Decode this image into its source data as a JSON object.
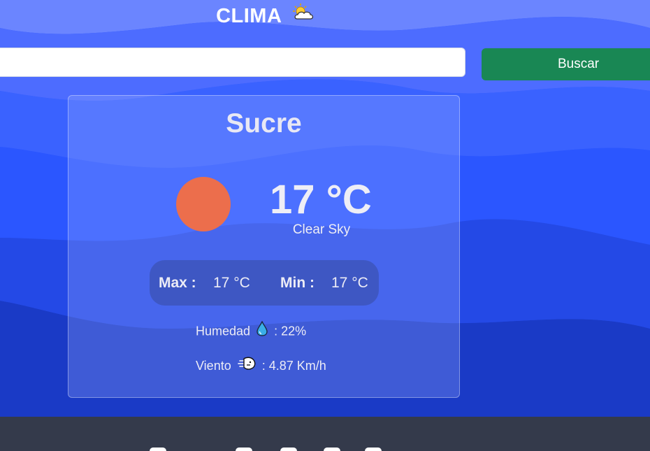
{
  "header": {
    "title": "CLIMA",
    "title_icon": "sun-behind-cloud-icon"
  },
  "search": {
    "value": "",
    "placeholder": "",
    "button_label": "Buscar"
  },
  "weather": {
    "city": "Sucre",
    "condition_icon": "sun-icon",
    "temperature": "17 °C",
    "description": "Clear Sky",
    "max_label": "Max :",
    "max_value": "17 °C",
    "min_label": "Min :",
    "min_value": "17 °C",
    "humidity_label": "Humedad",
    "humidity_icon": "droplet-icon",
    "humidity_value": ": 22%",
    "wind_label": "Viento",
    "wind_icon": "wind-face-icon",
    "wind_value": ": 4.87 Km/h"
  },
  "colors": {
    "background": "#2b58ff",
    "button": "#198754",
    "sun": "#ec6e4c",
    "footer": "#343a4b"
  }
}
